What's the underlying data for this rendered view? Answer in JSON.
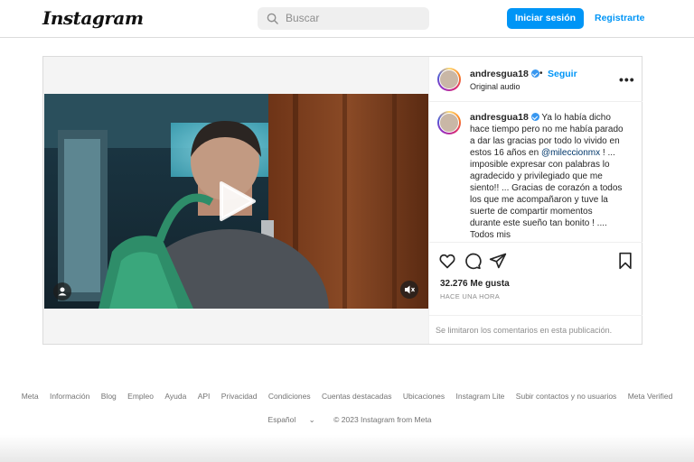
{
  "header": {
    "logo": "Instagram",
    "search_placeholder": "Buscar",
    "login_label": "Iniciar sesión",
    "register_label": "Registrarte"
  },
  "post": {
    "author": "andresgua18",
    "follow_label": "Seguir",
    "separator": "•",
    "audio_label": "Original audio",
    "more_label": "•••",
    "caption_part1": "Ya lo había dicho hace tiempo pero no me había parado a dar las gracias por todo lo vivido en estos 16 años en ",
    "caption_mention": "@mileccionmx",
    "caption_part2": " ! ... imposible expresar con palabras lo agradecido y privilegiado que me siento!! ... Gracias de corazón a todos los que me acompañaron y tuve la suerte de compartir momentos durante este sueño tan bonito ! .... Todos mis",
    "likes": "32.276 Me gusta",
    "time": "HACE UNA HORA",
    "comments_limited": "Se limitaron los comentarios en esta publicación."
  },
  "icons": {
    "search": "search-icon",
    "play": "play-icon",
    "user_tag": "user-tag-icon",
    "mute": "mute-icon",
    "like": "heart-icon",
    "comment": "comment-icon",
    "share": "share-icon",
    "save": "bookmark-icon",
    "verified": "verified-badge-icon"
  },
  "footer": {
    "links": [
      "Meta",
      "Información",
      "Blog",
      "Empleo",
      "Ayuda",
      "API",
      "Privacidad",
      "Condiciones",
      "Cuentas destacadas",
      "Ubicaciones",
      "Instagram Lite",
      "Subir contactos y no usuarios",
      "Meta Verified"
    ],
    "language": "Español",
    "copyright": "© 2023 Instagram from Meta"
  },
  "colors": {
    "accent": "#0095f6",
    "border": "#dbdbdb",
    "muted": "#8e8e8e"
  }
}
